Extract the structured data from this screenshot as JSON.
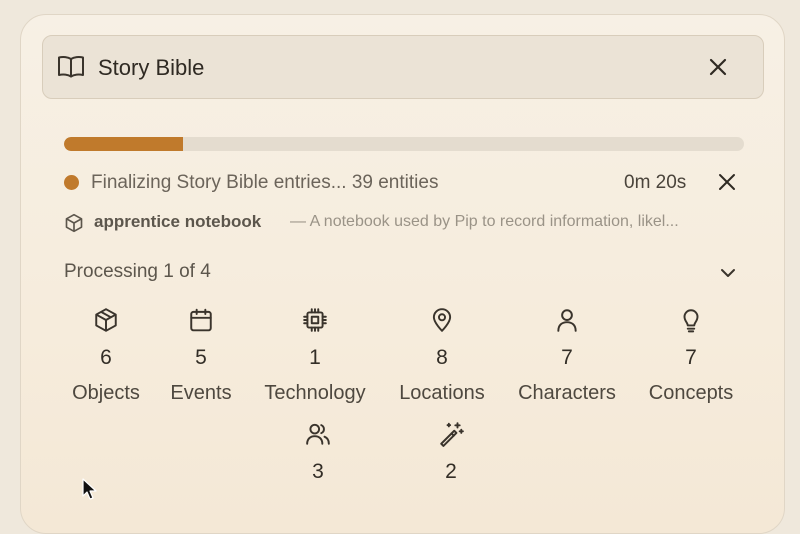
{
  "header": {
    "title": "Story Bible"
  },
  "progress": {
    "fraction": 0.175,
    "fill_color": "#c07a2c"
  },
  "status": {
    "text": "Finalizing Story Bible entries... 39 entities",
    "timer": "0m 20s",
    "dot_color": "#c07a2c"
  },
  "current_entity": {
    "name": "apprentice notebook",
    "description": "— A notebook used by Pip to record information, likel..."
  },
  "processing": {
    "text": "Processing 1 of 4"
  },
  "categories": [
    {
      "icon": "cube-icon",
      "count": "6",
      "label": "Objects"
    },
    {
      "icon": "calendar-icon",
      "count": "5",
      "label": "Events"
    },
    {
      "icon": "chip-icon",
      "count": "1",
      "label": "Technology"
    },
    {
      "icon": "map-pin-icon",
      "count": "8",
      "label": "Locations"
    },
    {
      "icon": "person-icon",
      "count": "7",
      "label": "Characters"
    },
    {
      "icon": "lightbulb-icon",
      "count": "7",
      "label": "Concepts"
    },
    {
      "icon": "users-icon",
      "count": "3",
      "label": ""
    },
    {
      "icon": "magic-wand-icon",
      "count": "2",
      "label": ""
    }
  ]
}
